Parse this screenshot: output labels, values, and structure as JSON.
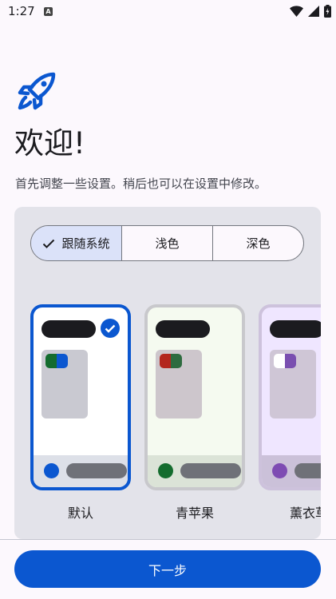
{
  "status_bar": {
    "time": "1:27",
    "notification_letter": "A"
  },
  "welcome": {
    "title": "欢迎!",
    "subtitle": "首先调整一些设置。稍后也可以在设置中修改。"
  },
  "theme_mode": {
    "options": [
      {
        "label": "跟随系统",
        "selected": true
      },
      {
        "label": "浅色",
        "selected": false
      },
      {
        "label": "深色",
        "selected": false
      }
    ]
  },
  "themes": [
    {
      "label": "默认",
      "selected": true,
      "card_bg": "#ffffff",
      "box": "#c9c9d1",
      "dot_left": "#146c2e",
      "dot_right": "#0b57d0",
      "bottom_bg": "#dde0e8",
      "bottom_dot": "#0b57d0",
      "border": "#0b57d0"
    },
    {
      "label": "青苹果",
      "selected": false,
      "card_bg": "#f5faf0",
      "box": "#cdc6cc",
      "dot_left": "#b3261e",
      "dot_right": "#2e6b3f",
      "bottom_bg": "#dbe3d7",
      "bottom_dot": "#146c2e",
      "border": "#c8c8cc"
    },
    {
      "label": "薰衣草",
      "selected": false,
      "card_bg": "#efe6ff",
      "box": "#cfc6d6",
      "dot_left": "#ffffff",
      "dot_right": "#7a4fb0",
      "bottom_bg": "#cbc1d9",
      "bottom_dot": "#7e4cb3",
      "border": "#cdc2dc"
    }
  ],
  "footer": {
    "next_label": "下一步"
  },
  "colors": {
    "accent": "#0b57d0"
  }
}
